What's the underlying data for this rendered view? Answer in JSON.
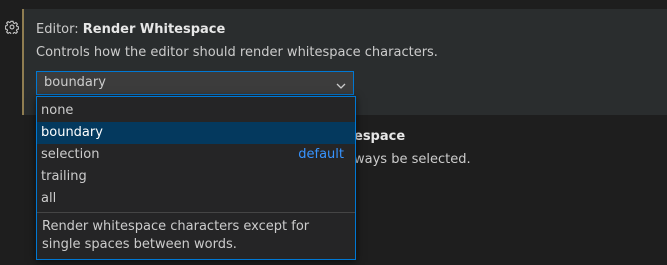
{
  "setting": {
    "category": "Editor: ",
    "name": "Render Whitespace",
    "description": "Controls how the editor should render whitespace characters.",
    "current_value": "boundary"
  },
  "dropdown": {
    "options": [
      {
        "label": "none",
        "badge": ""
      },
      {
        "label": "boundary",
        "badge": "",
        "selected": true
      },
      {
        "label": "selection",
        "badge": "default"
      },
      {
        "label": "trailing",
        "badge": ""
      },
      {
        "label": "all",
        "badge": ""
      }
    ],
    "description": "Render whitespace characters except for single spaces between words."
  },
  "next_setting": {
    "title_fragment": "espace",
    "desc_fragment": "ways be selected."
  },
  "icons": {
    "gear": "gear-icon",
    "chevron": "chevron-down-icon"
  },
  "colors": {
    "background": "#1e1e1e",
    "focused_row": "#2a2d2e",
    "modified_accent": "#8f7d51",
    "focus_border": "#0078d4",
    "selected_option": "#04395e",
    "default_badge": "#3794ff"
  }
}
